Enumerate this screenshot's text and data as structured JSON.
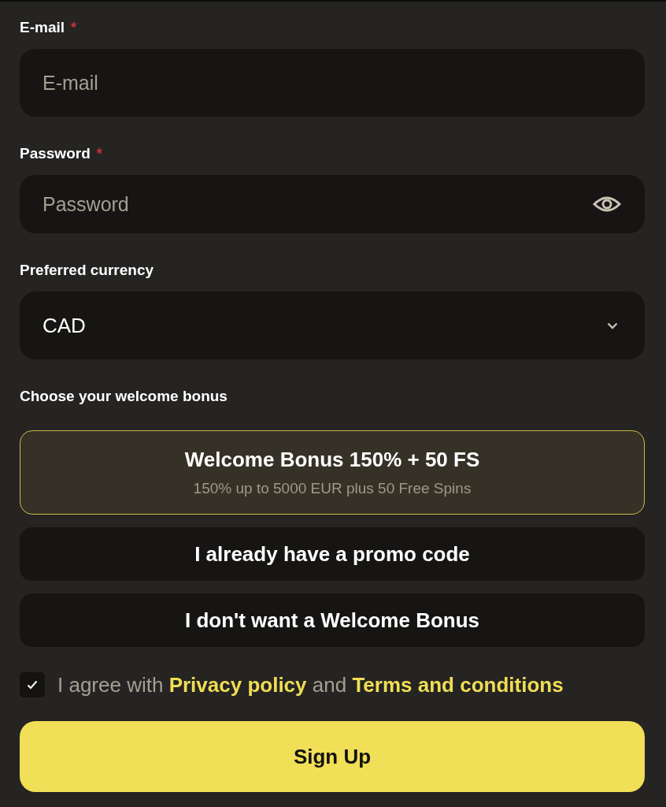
{
  "fields": [
    {
      "kind": "text",
      "label": "E-mail",
      "required_mark": "*",
      "placeholder": "E-mail"
    },
    {
      "kind": "password",
      "label": "Password",
      "required_mark": "*",
      "placeholder": "Password"
    },
    {
      "kind": "select",
      "label": "Preferred currency",
      "value": "CAD"
    }
  ],
  "bonus": {
    "label": "Choose your welcome bonus",
    "options": [
      {
        "title": "Welcome Bonus 150% + 50 FS",
        "subtitle": "150% up to 5000 EUR plus 50 Free Spins",
        "selected": true
      },
      {
        "title": "I already have a promo code",
        "selected": false
      },
      {
        "title": "I don't want a Welcome Bonus",
        "selected": false
      }
    ]
  },
  "agreement": {
    "checked": true,
    "parts": [
      {
        "kind": "text",
        "text": "I agree with"
      },
      {
        "kind": "link",
        "text": "Privacy policy"
      },
      {
        "kind": "text",
        "text": "and"
      },
      {
        "kind": "link",
        "text": "Terms and conditions"
      }
    ]
  },
  "submit": "Sign Up"
}
